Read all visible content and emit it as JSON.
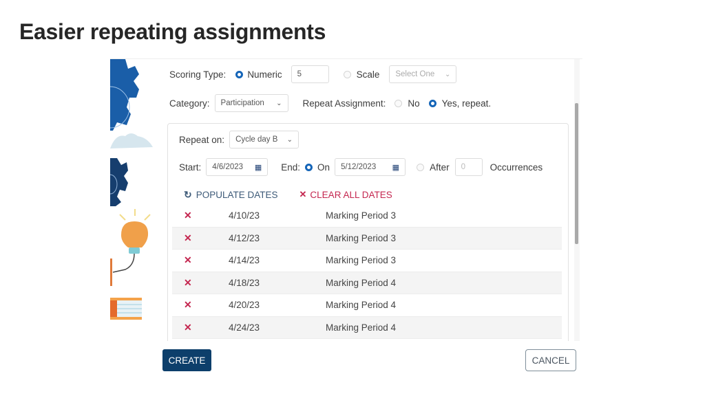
{
  "slide": {
    "title": "Easier repeating assignments"
  },
  "form": {
    "scoring_type": {
      "label": "Scoring Type:",
      "options": [
        {
          "label": "Numeric",
          "selected": true
        },
        {
          "label": "Scale",
          "selected": false
        }
      ],
      "numeric_value": "5",
      "scale_select": {
        "value": "Select One"
      }
    },
    "category": {
      "label": "Category:",
      "value": "Participation"
    },
    "repeat_assignment": {
      "label": "Repeat Assignment:",
      "options": [
        {
          "label": "No",
          "selected": false
        },
        {
          "label": "Yes, repeat.",
          "selected": true
        }
      ]
    },
    "repeat_panel": {
      "repeat_on": {
        "label": "Repeat on:",
        "value": "Cycle day B"
      },
      "start": {
        "label": "Start:",
        "value": "4/6/2023"
      },
      "end": {
        "label": "End:",
        "on_label": "On",
        "on_selected": true,
        "on_value": "5/12/2023",
        "after_label": "After",
        "after_selected": false,
        "after_value": "0",
        "occurrences_label": "Occurrences"
      },
      "populate_label": "POPULATE DATES",
      "clear_label": "CLEAR ALL DATES",
      "dates": [
        {
          "date": "4/10/23",
          "period": "Marking Period 3"
        },
        {
          "date": "4/12/23",
          "period": "Marking Period 3"
        },
        {
          "date": "4/14/23",
          "period": "Marking Period 3"
        },
        {
          "date": "4/18/23",
          "period": "Marking Period 4"
        },
        {
          "date": "4/20/23",
          "period": "Marking Period 4"
        },
        {
          "date": "4/24/23",
          "period": "Marking Period 4"
        }
      ]
    }
  },
  "footer": {
    "create_label": "CREATE",
    "cancel_label": "CANCEL"
  },
  "colors": {
    "accent": "#1565b8",
    "danger": "#c4264f",
    "primary_button": "#0d3f6b",
    "link": "#3d5a78"
  }
}
